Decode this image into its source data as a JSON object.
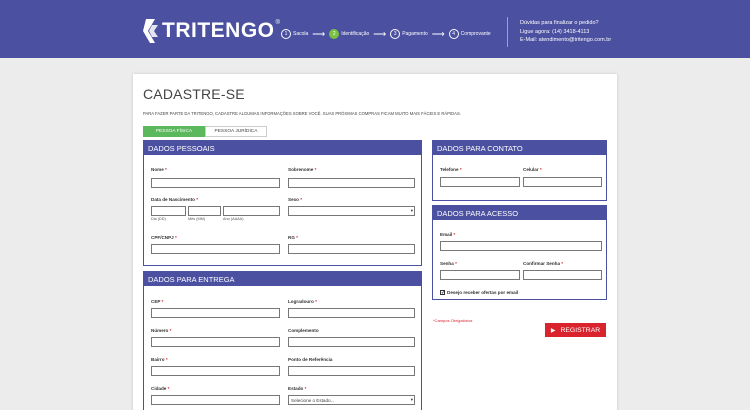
{
  "header": {
    "logo_text": "TRITENGO",
    "logo_reg": "®",
    "steps": [
      {
        "num": "1",
        "label": "Sacola"
      },
      {
        "num": "2",
        "label": "Identificação"
      },
      {
        "num": "3",
        "label": "Pagamento"
      },
      {
        "num": "4",
        "label": "Comprovante"
      }
    ],
    "arrow": "⟶",
    "help_line1": "Dúvidas para finalizar o pedido?",
    "help_line2": "Ligue agora: (14) 3418-4113",
    "help_line3": "E-Mail: atendimento@tritengo.com.br"
  },
  "page": {
    "title": "CADASTRE-SE",
    "intro": "PARA FAZER PARTE DA TRITENGO, CADASTRE ALGUMAS INFORMAÇÕES SOBRE VOCÊ. SUAS PRÓXIMAS COMPRAS FICAM MUITO MAIS FÁCEIS E RÁPIDAS.",
    "tab_pf": "PESSOA FÍSICA",
    "tab_pj": "PESSOA JURÍDICA",
    "required_note": "*Campos Obrigatórios",
    "register_label": "REGISTRAR",
    "required_mark": "*"
  },
  "dados_pessoais": {
    "title": "DADOS PESSOAIS",
    "nome": "Nome",
    "sobrenome": "Sobrenome",
    "nascimento": "Data de Nascimento",
    "dia": "Dia (DD)",
    "mes": "Mês (MM)",
    "ano": "Ano (AAAA)",
    "sexo": "Sexo",
    "cpf": "CPF/CNPJ",
    "rg": "RG"
  },
  "dados_entrega": {
    "title": "DADOS PARA ENTREGA",
    "cep": "CEP",
    "logradouro": "Logradouro",
    "numero": "Número",
    "complemento": "Complemento",
    "bairro": "Bairro",
    "referencia": "Ponto de Referência",
    "cidade": "Cidade",
    "estado": "Estado",
    "estado_selected": "Selecione o Estado..."
  },
  "dados_contato": {
    "title": "DADOS PARA CONTATO",
    "telefone": "Telefone",
    "celular": "Celular"
  },
  "dados_acesso": {
    "title": "DADOS PARA ACESSO",
    "email": "Email",
    "senha": "Senha",
    "confirmar": "Confirmar Senha",
    "ofertas": "Desejo receber ofertas por email",
    "check_mark": "✓"
  },
  "colors": {
    "brand": "#4b50a0",
    "active_step": "#7ac142",
    "tab_active": "#5cb85c",
    "register": "#d9232d"
  }
}
